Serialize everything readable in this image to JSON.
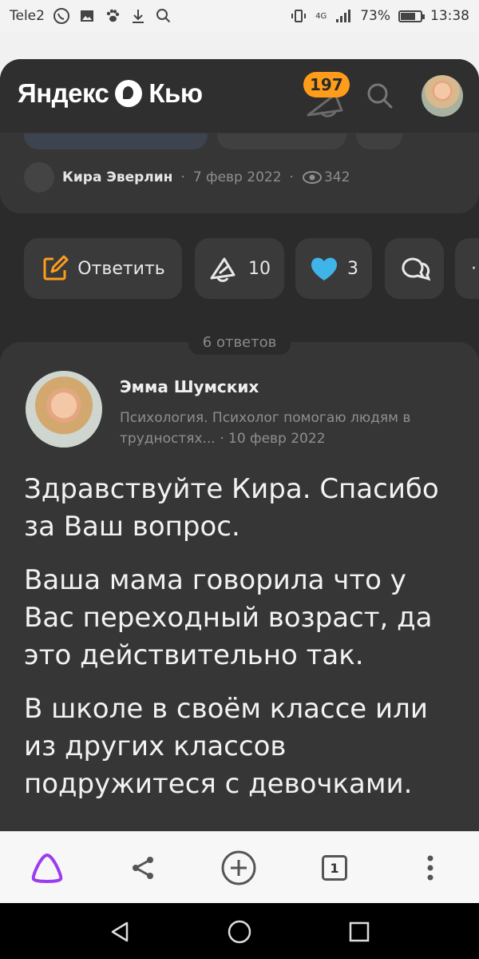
{
  "status_bar": {
    "carrier": "Tele2",
    "network": "4G",
    "battery": "73%",
    "battery_level": 0.73,
    "time": "13:38"
  },
  "header": {
    "logo_text_1": "Яндекс",
    "logo_text_2": "Кью",
    "notifications_count": "197",
    "accent_color": "#ff9d1b"
  },
  "question_meta": {
    "author": "Кира Эверлин",
    "date": "7 февр 2022",
    "views": "342"
  },
  "actions": {
    "reply_label": "Ответить",
    "upvotes": "10",
    "likes": "3"
  },
  "answers": {
    "count_label": "6 ответов"
  },
  "answer": {
    "author": "Эмма Шумских",
    "description": "Психология. Психолог помогаю людям в трудностях...",
    "date": "10 февр 2022",
    "paragraphs": [
      "Здравствуйте Кира. Спасибо за Ваш вопрос.",
      "Ваша мама говорила что у Вас переходный возраст, да это действительно так.",
      "В школе в своём классе или из других классов подружитеся с девочками."
    ]
  },
  "bottom_bar": {
    "tabs_count": "1"
  }
}
